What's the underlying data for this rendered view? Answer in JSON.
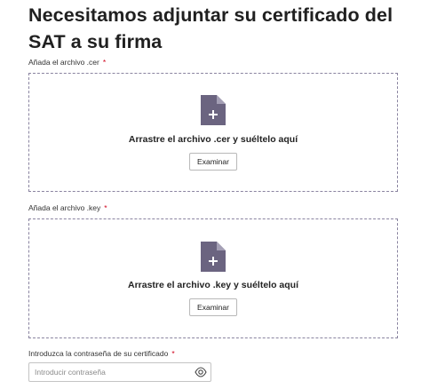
{
  "page": {
    "title": "Necesitamos adjuntar su certificado del SAT a su firma"
  },
  "cer_upload": {
    "label": "Añada el archivo .cer",
    "required_mark": "*",
    "drop_text": "Arrastre el archivo .cer y suéltelo aquí",
    "button_label": "Examinar",
    "icon": "file-add-icon"
  },
  "key_upload": {
    "label": "Añada el archivo .key",
    "required_mark": "*",
    "drop_text": "Arrastre el archivo .key y suéltelo aquí",
    "button_label": "Examinar",
    "icon": "file-add-icon"
  },
  "password": {
    "label": "Introduzca la contraseña de su certificado",
    "required_mark": "*",
    "placeholder": "Introducir contraseña",
    "value": "",
    "icon": "eye-icon"
  },
  "colors": {
    "icon_fill": "#6b6480",
    "dashed_border": "#8a84a0",
    "required": "#d0021b"
  }
}
